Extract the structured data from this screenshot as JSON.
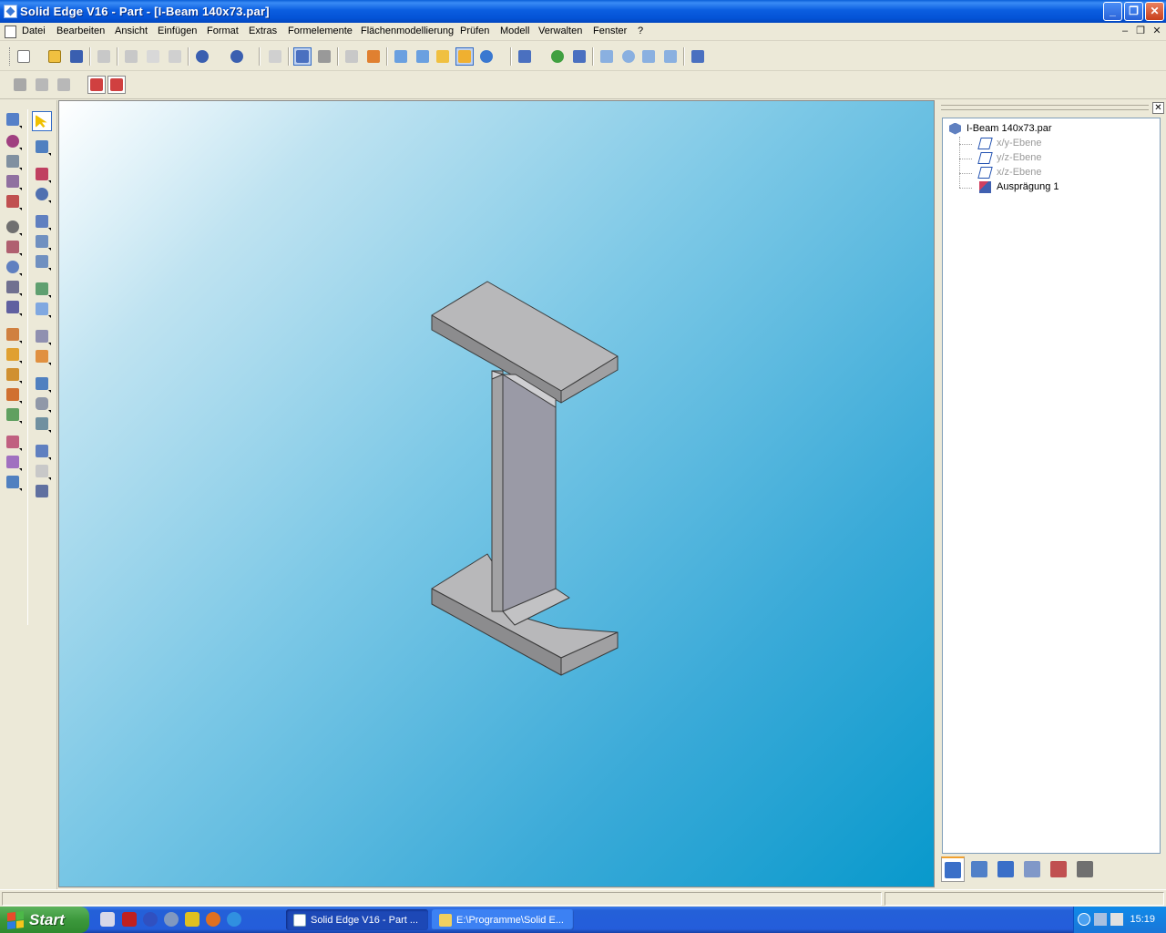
{
  "window": {
    "title": "Solid Edge V16 - Part - [I-Beam 140x73.par]",
    "minimize": "_",
    "maximize": "❐",
    "close": "✕"
  },
  "menubar": {
    "items": [
      "Datei",
      "Bearbeiten",
      "Ansicht",
      "Einfügen",
      "Format",
      "Extras",
      "Formelemente",
      "Flächenmodellierung",
      "Prüfen",
      "Modell",
      "Verwalten",
      "Fenster",
      "?"
    ],
    "mdi_min": "–",
    "mdi_restore": "❐",
    "mdi_close": "✕"
  },
  "colors": {
    "accent": "#0a5fd8",
    "viewport_start": "#ffffff",
    "viewport_end": "#0899cc",
    "model_face": "#b6b6b8",
    "model_edge": "#3a3a3a"
  },
  "feature_tree": {
    "root": "I-Beam 140x73.par",
    "items": [
      {
        "label": "x/y-Ebene",
        "icon": "plane-icon",
        "dimmed": true
      },
      {
        "label": "y/z-Ebene",
        "icon": "plane-icon",
        "dimmed": true
      },
      {
        "label": "x/z-Ebene",
        "icon": "plane-icon",
        "dimmed": true
      },
      {
        "label": "Ausprägung 1",
        "icon": "extrusion-icon",
        "dimmed": false
      }
    ],
    "close": "✕"
  },
  "taskbar": {
    "start": "Start",
    "tasks": [
      {
        "label": "Solid Edge V16 - Part ...",
        "active": true
      },
      {
        "label": "E:\\Programme\\Solid E...",
        "active": false
      }
    ],
    "clock": "15:19"
  }
}
